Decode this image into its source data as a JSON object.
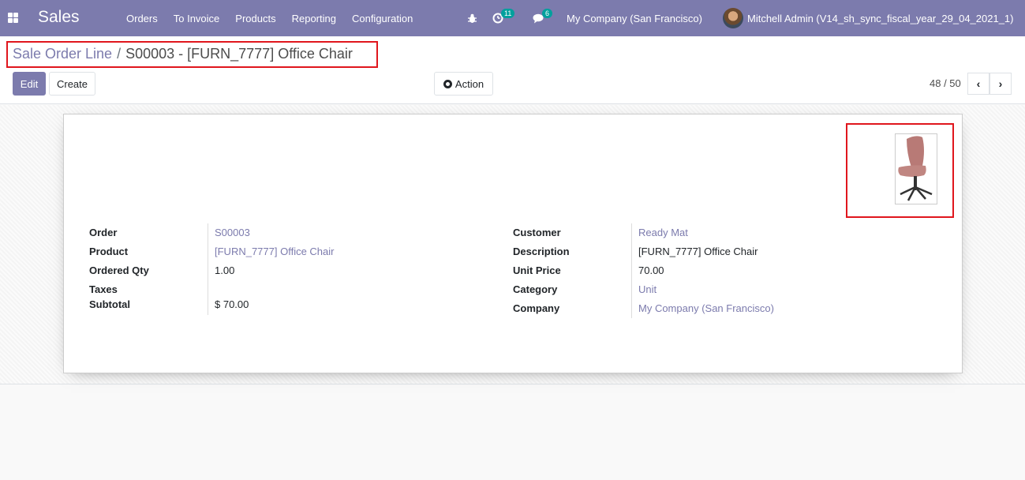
{
  "nav": {
    "app_title": "Sales",
    "menu": [
      "Orders",
      "To Invoice",
      "Products",
      "Reporting",
      "Configuration"
    ],
    "activity_count": "11",
    "message_count": "6",
    "company": "My Company (San Francisco)",
    "user": "Mitchell Admin (V14_sh_sync_fiscal_year_29_04_2021_1)"
  },
  "breadcrumb": {
    "parent": "Sale Order Line",
    "separator": "/",
    "current": "S00003 - [FURN_7777] Office Chair"
  },
  "buttons": {
    "edit": "Edit",
    "create": "Create",
    "action": "Action"
  },
  "pager": {
    "value": "48 / 50",
    "prev": "‹",
    "next": "›"
  },
  "form": {
    "left": [
      {
        "label": "Order",
        "value": "S00003"
      },
      {
        "label": "Product",
        "value": "[FURN_7777] Office Chair"
      },
      {
        "label": "Ordered Qty",
        "value": "1.00"
      },
      {
        "label": "Taxes",
        "value": ""
      },
      {
        "label": "Subtotal",
        "value": "$ 70.00"
      }
    ],
    "right": [
      {
        "label": "Customer",
        "value": "Ready Mat"
      },
      {
        "label": "Description",
        "value": "[FURN_7777] Office Chair"
      },
      {
        "label": "Unit Price",
        "value": "70.00"
      },
      {
        "label": "Category",
        "value": "Unit"
      },
      {
        "label": "Company",
        "value": "My Company (San Francisco)"
      }
    ]
  },
  "icons": {
    "apps": "apps-grid-icon",
    "bug": "bug-icon",
    "activity": "clock-icon",
    "messages": "chat-icon",
    "action": "gear-icon",
    "product_image": "office-chair-image"
  },
  "colors": {
    "brand": "#7c7bad",
    "highlight_border": "#e0161d",
    "badge": "#00a09d"
  }
}
